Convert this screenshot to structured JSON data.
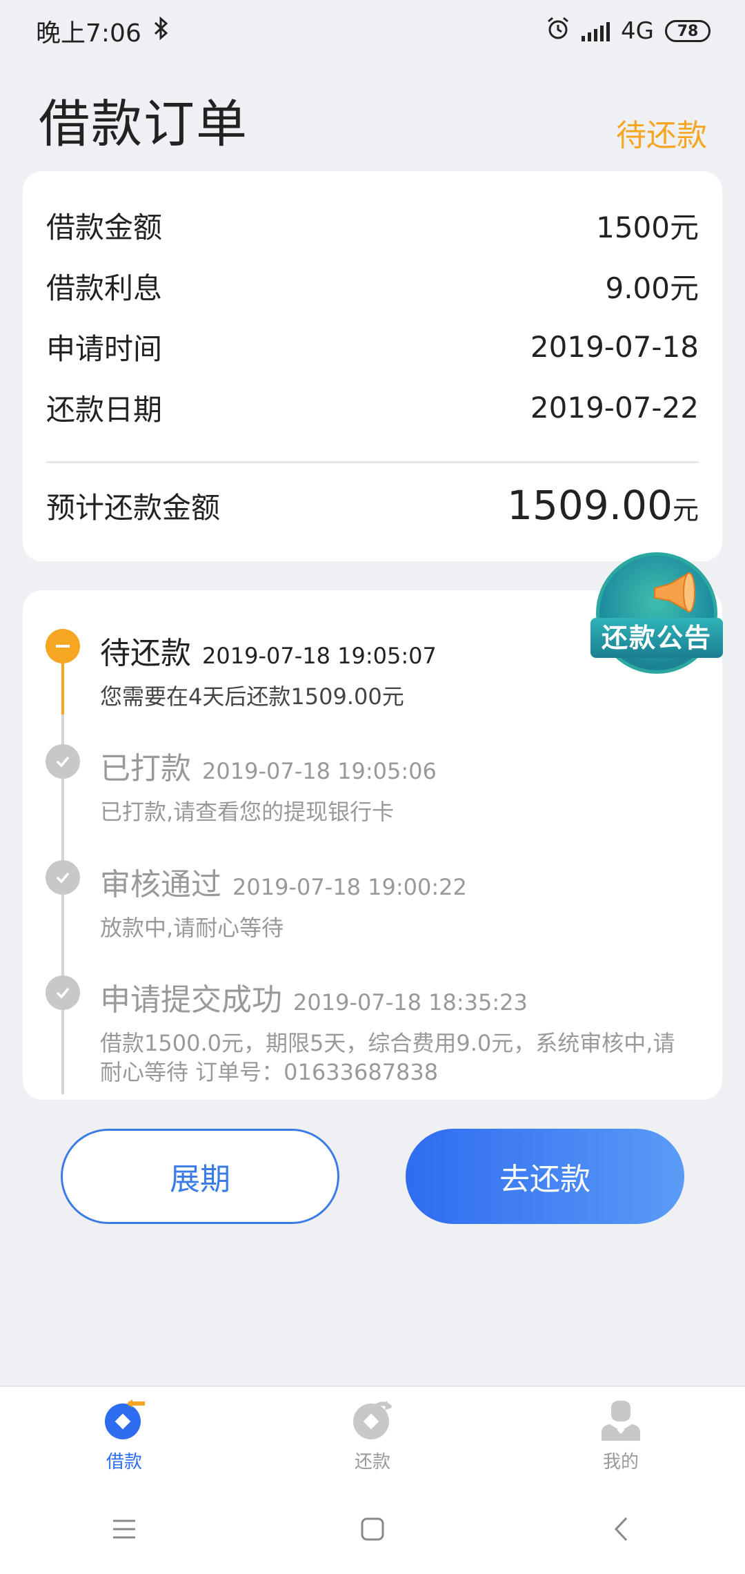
{
  "status_bar": {
    "time": "晚上7:06",
    "network": "4G",
    "battery": "78"
  },
  "header": {
    "title": "借款订单",
    "status": "待还款"
  },
  "summary": {
    "rows": [
      {
        "label": "借款金额",
        "value": "1500元"
      },
      {
        "label": "借款利息",
        "value": "9.00元"
      },
      {
        "label": "申请时间",
        "value": "2019-07-18"
      },
      {
        "label": "还款日期",
        "value": "2019-07-22"
      }
    ],
    "total_label": "预计还款金额",
    "total_value": "1509.00",
    "total_unit": "元"
  },
  "announcement": {
    "label": "还款公告"
  },
  "timeline": [
    {
      "title": "待还款",
      "time": "2019-07-18 19:05:07",
      "desc": "您需要在4天后还款1509.00元",
      "active": true
    },
    {
      "title": "已打款",
      "time": "2019-07-18 19:05:06",
      "desc": "已打款,请查看您的提现银行卡",
      "active": false
    },
    {
      "title": "审核通过",
      "time": "2019-07-18 19:00:22",
      "desc": "放款中,请耐心等待",
      "active": false
    },
    {
      "title": "申请提交成功",
      "time": "2019-07-18 18:35:23",
      "desc": "借款1500.0元，期限5天，综合费用9.0元，系统审核中,请耐心等待 订单号：01633687838",
      "active": false
    }
  ],
  "actions": {
    "extend": "展期",
    "repay": "去还款"
  },
  "bottom_nav": [
    {
      "label": "借款",
      "icon": "loan-icon",
      "active": true
    },
    {
      "label": "还款",
      "icon": "repay-icon",
      "active": false
    },
    {
      "label": "我的",
      "icon": "profile-icon",
      "active": false
    }
  ],
  "colors": {
    "accent_orange": "#f5a623",
    "primary_blue": "#2e6cf0"
  }
}
